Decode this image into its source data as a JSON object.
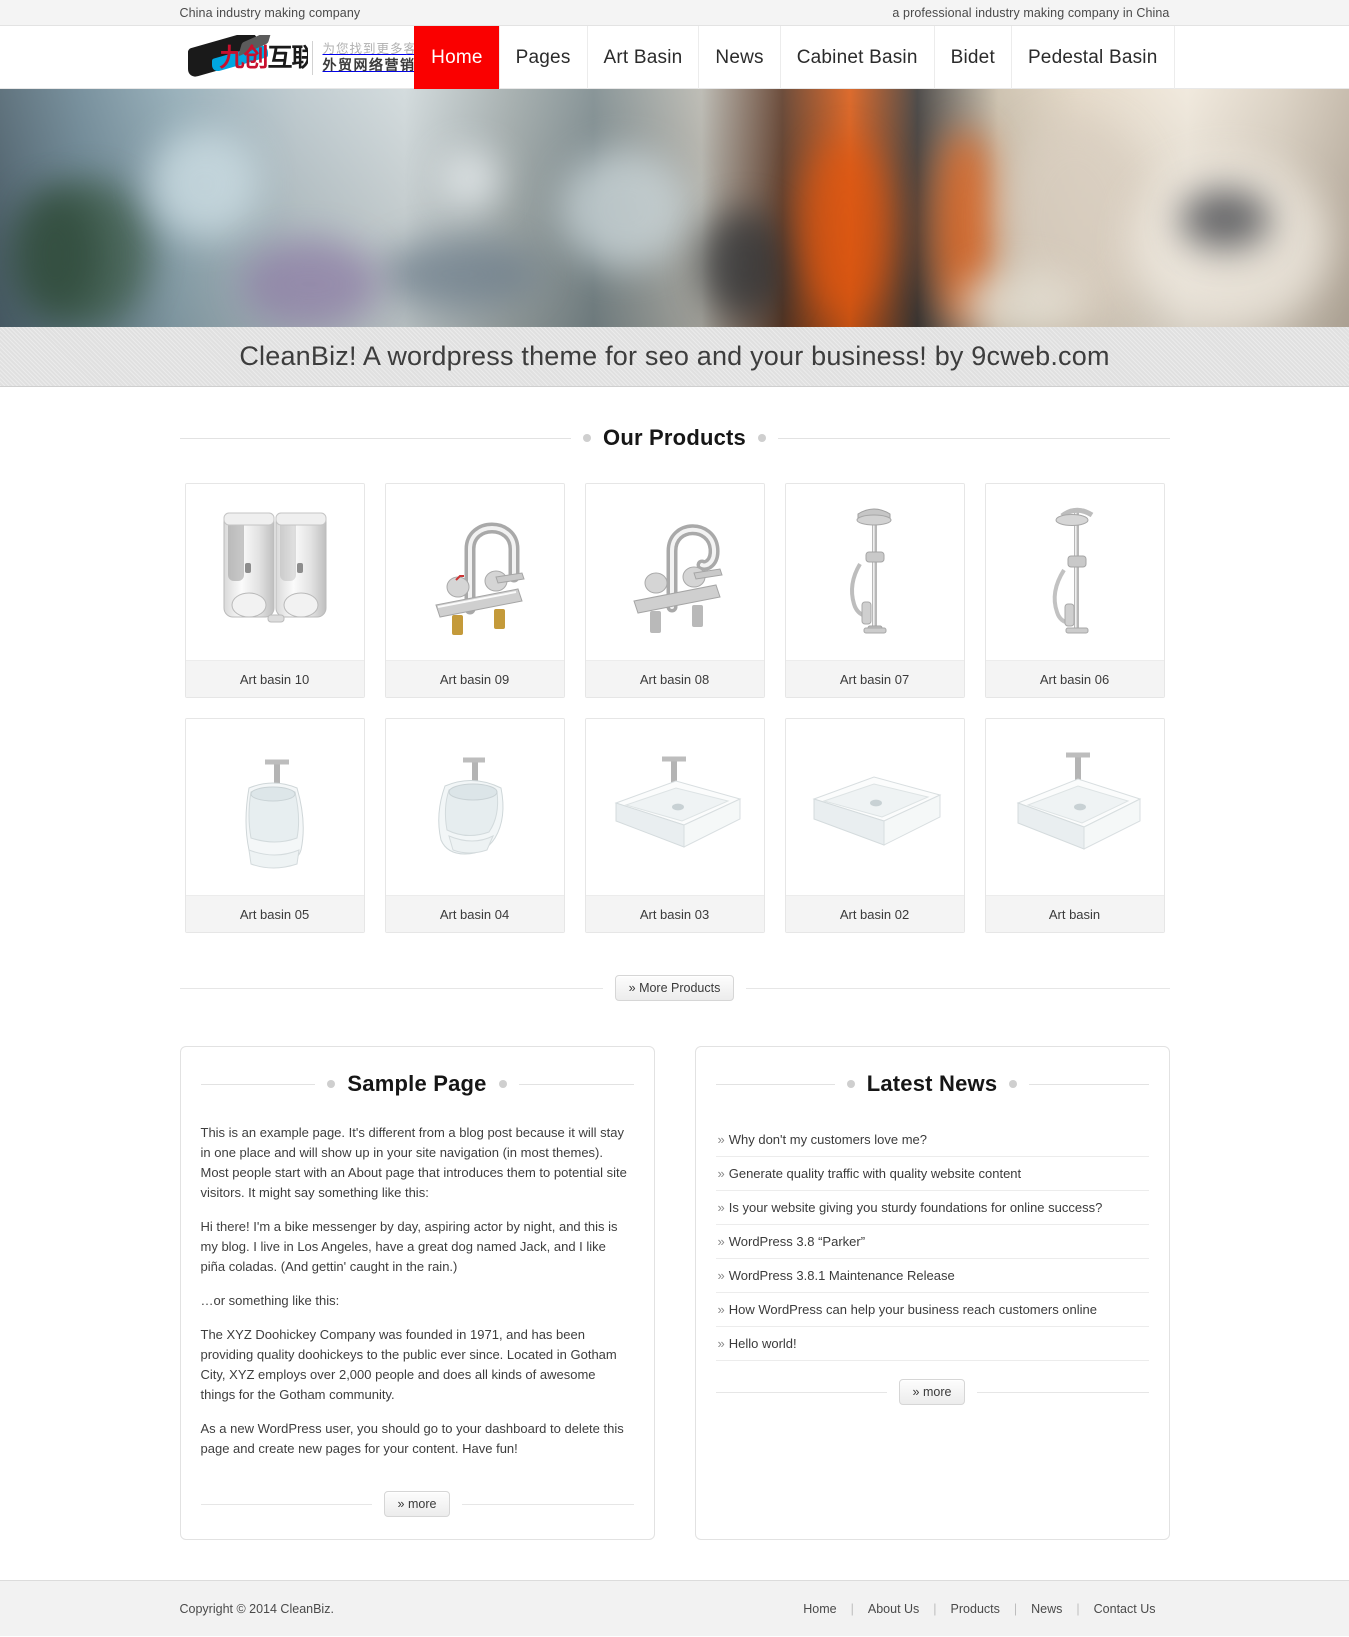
{
  "topbar": {
    "left": "China industry making company",
    "right": "a professional industry making company in China"
  },
  "logo": {
    "cn_red": "九创",
    "cn_black": "互联",
    "tagline_line1": "为您找到更多客户",
    "tagline_line2": "外贸网络营销"
  },
  "nav": {
    "items": [
      {
        "label": "Home",
        "active": true
      },
      {
        "label": "Pages",
        "active": false
      },
      {
        "label": "Art Basin",
        "active": false
      },
      {
        "label": "News",
        "active": false
      },
      {
        "label": "Cabinet Basin",
        "active": false
      },
      {
        "label": "Bidet",
        "active": false
      },
      {
        "label": "Pedestal Basin",
        "active": false
      }
    ]
  },
  "hero": {
    "tagline": "CleanBiz! A wordpress theme for seo and your business! by 9cweb.com"
  },
  "products": {
    "title": "Our Products",
    "more_label": "» More Products",
    "row1": [
      {
        "name": "Art basin 10",
        "icon": "soap-dispenser-icon"
      },
      {
        "name": "Art basin 09",
        "icon": "gooseneck-faucet-icon"
      },
      {
        "name": "Art basin 08",
        "icon": "curved-faucet-icon"
      },
      {
        "name": "Art basin 07",
        "icon": "shower-column-icon"
      },
      {
        "name": "Art basin 06",
        "icon": "shower-set-icon"
      }
    ],
    "row2": [
      {
        "name": "Art basin 05",
        "icon": "bidet-icon"
      },
      {
        "name": "Art basin 04",
        "icon": "wall-bidet-icon"
      },
      {
        "name": "Art basin 03",
        "icon": "rect-basin-icon"
      },
      {
        "name": "Art basin 02",
        "icon": "rect-basin-plain-icon"
      },
      {
        "name": "Art basin",
        "icon": "square-basin-icon"
      }
    ]
  },
  "sample_page": {
    "title": "Sample Page",
    "paragraphs": [
      "This is an example page. It's different from a blog post because it will stay in one place and will show up in your site navigation (in most themes). Most people start with an About page that introduces them to potential site visitors. It might say something like this:",
      "Hi there! I'm a bike messenger by day, aspiring actor by night, and this is my blog. I live in Los Angeles, have a great dog named Jack, and I like piña coladas. (And gettin' caught in the rain.)",
      "…or something like this:",
      "The XYZ Doohickey Company was founded in 1971, and has been providing quality doohickeys to the public ever since. Located in Gotham City, XYZ employs over 2,000 people and does all kinds of awesome things for the Gotham community.",
      "As a new WordPress user, you should go to your dashboard to delete this page and create new pages for your content. Have fun!"
    ],
    "more_label": "» more"
  },
  "latest_news": {
    "title": "Latest News",
    "more_label": "» more",
    "items": [
      "Why don't my customers love me?",
      "Generate quality traffic with quality website content",
      "Is your website giving you sturdy foundations for online success?",
      "WordPress 3.8 “Parker”",
      "WordPress 3.8.1 Maintenance Release",
      "How WordPress can help your business reach customers online",
      "Hello world!"
    ]
  },
  "footer": {
    "copyright": "Copyright © 2014 CleanBiz.",
    "links": [
      "Home",
      "About Us",
      "Products",
      "News",
      "Contact Us"
    ],
    "separator": "|"
  },
  "colors": {
    "accent_red": "#fa0000",
    "logo_red": "#c8102e",
    "logo_blue": "#00a7e1",
    "tagline_bg": "#e0e0e0",
    "footer_bg": "#f2f2f2"
  }
}
